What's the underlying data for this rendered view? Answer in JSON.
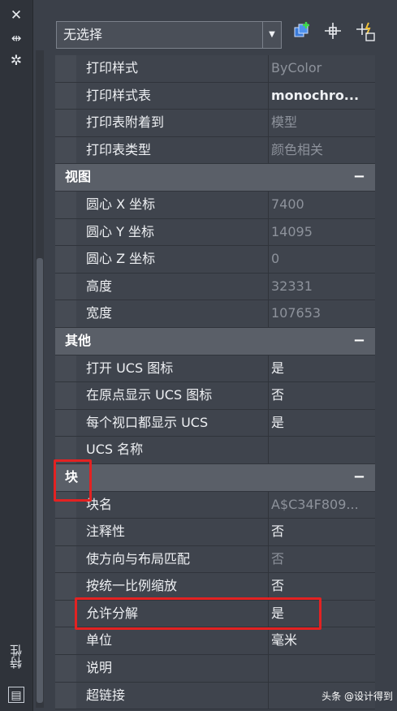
{
  "panel": {
    "title": "特性",
    "selection": "无选择"
  },
  "sections": [
    {
      "title": null,
      "rows": [
        {
          "name": "打印样式",
          "value": "ByColor",
          "dim": true
        },
        {
          "name": "打印样式表",
          "value": "monochro...",
          "dim": false
        },
        {
          "name": "打印表附着到",
          "value": "模型",
          "dim": true
        },
        {
          "name": "打印表类型",
          "value": "颜色相关",
          "dim": true
        }
      ]
    },
    {
      "title": "视图",
      "collapse": "−",
      "rows": [
        {
          "name": "圆心 X 坐标",
          "value": "7400",
          "dim": true
        },
        {
          "name": "圆心 Y 坐标",
          "value": "14095",
          "dim": true
        },
        {
          "name": "圆心 Z 坐标",
          "value": "0",
          "dim": true
        },
        {
          "name": "高度",
          "value": "32331",
          "dim": true
        },
        {
          "name": "宽度",
          "value": "107653",
          "dim": true
        }
      ]
    },
    {
      "title": "其他",
      "collapse": "−",
      "rows": [
        {
          "name": "打开 UCS 图标",
          "value": "是",
          "dim": false
        },
        {
          "name": "在原点显示 UCS 图标",
          "value": "否",
          "dim": false
        },
        {
          "name": "每个视口都显示 UCS",
          "value": "是",
          "dim": false
        },
        {
          "name": "UCS 名称",
          "value": "",
          "dim": false
        }
      ]
    },
    {
      "title": "块",
      "collapse": "−",
      "rows": [
        {
          "name": "块名",
          "value": "A$C34F809...",
          "dim": true
        },
        {
          "name": "注释性",
          "value": "否",
          "dim": false
        },
        {
          "name": "使方向与布局匹配",
          "value": "否",
          "dim": true
        },
        {
          "name": "按统一比例缩放",
          "value": "否",
          "dim": false
        },
        {
          "name": "允许分解",
          "value": "是",
          "dim": false
        },
        {
          "name": "单位",
          "value": "毫米",
          "dim": false
        },
        {
          "name": "说明",
          "value": "",
          "dim": false
        },
        {
          "name": "超链接",
          "value": "",
          "dim": false
        }
      ]
    }
  ],
  "watermark": {
    "text": "头条 @设计得到"
  },
  "colors": {
    "highlight": "#e32222",
    "panel_bg": "#3f444d",
    "section_bg": "#5a5f68"
  },
  "icons": {
    "strip": [
      "close-icon",
      "pin-icon",
      "settings-icon"
    ],
    "toolbar": [
      "add-to-selection-icon",
      "select-objects-icon",
      "quick-select-icon"
    ]
  }
}
